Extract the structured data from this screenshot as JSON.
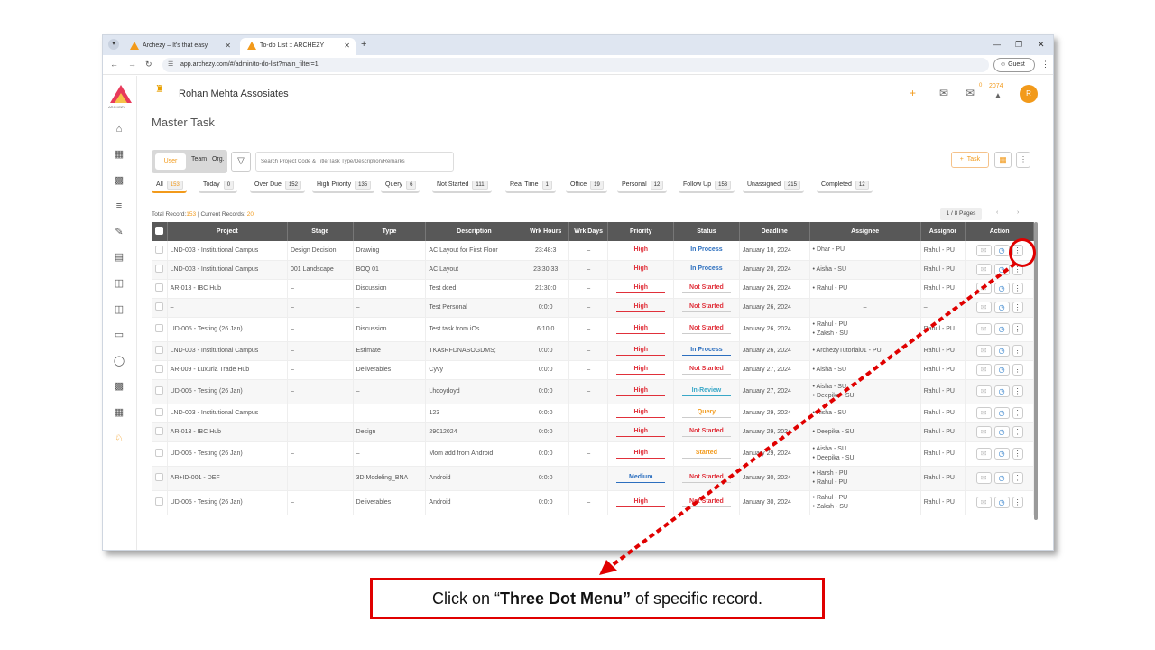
{
  "browser": {
    "tabs": [
      {
        "title": "Archezy – It's that easy"
      },
      {
        "title": "To-do List :: ARCHEZY"
      }
    ],
    "url": "app.archezy.com/#/admin/to-do-list?main_filter=1",
    "profile": "Guest"
  },
  "header": {
    "logo_text": "ARCHEZY",
    "org_name": "Rohan Mehta Assosiates",
    "chat_badge": "0",
    "notif_year": "2074",
    "avatar_letter": "R"
  },
  "page": {
    "title": "Master Task",
    "toggle": {
      "user": "User",
      "team": "Team",
      "org": "Org."
    },
    "search_placeholder": "Search Project Code & Title/Task Type/Description/Remarks",
    "add_task_label": "Task",
    "total_label": "Total Record:",
    "total_value": "153",
    "current_label": " | Current Records: ",
    "current_value": "20",
    "pager": "1 / 8 Pages"
  },
  "filters": [
    {
      "label": "All",
      "count": "153"
    },
    {
      "label": "Today",
      "count": "0"
    },
    {
      "label": "Over Due",
      "count": "152"
    },
    {
      "label": "High Priority",
      "count": "135"
    },
    {
      "label": "Query",
      "count": "6"
    },
    {
      "label": "Not Started",
      "count": "111"
    },
    {
      "label": "Real Time",
      "count": "1"
    },
    {
      "label": "Office",
      "count": "19"
    },
    {
      "label": "Personal",
      "count": "12"
    },
    {
      "label": "Follow Up",
      "count": "153"
    },
    {
      "label": "Unassigned",
      "count": "215"
    },
    {
      "label": "Completed",
      "count": "12"
    }
  ],
  "table": {
    "columns": [
      "Project",
      "Stage",
      "Type",
      "Description",
      "Wrk Hours",
      "Wrk Days",
      "Priority",
      "Status",
      "Deadline",
      "Assignee",
      "Assignor",
      "Action"
    ],
    "rows": [
      {
        "project": "LND-003 - Institutional Campus",
        "stage": "Design Decision",
        "type": "Drawing",
        "desc": "AC Layout for First Floor",
        "hours": "23:48:3",
        "days": "–",
        "priority": "High",
        "status": "In Process",
        "deadline": "January 10, 2024",
        "assignee": [
          "Dhar - PU"
        ],
        "assignor": "Rahul - PU"
      },
      {
        "project": "LND-003 - Institutional Campus",
        "stage": "001 Landscape",
        "type": "BOQ 01",
        "desc": "AC Layout",
        "hours": "23:30:33",
        "days": "–",
        "priority": "High",
        "status": "In Process",
        "deadline": "January 20, 2024",
        "assignee": [
          "Aisha - SU"
        ],
        "assignor": "Rahul - PU"
      },
      {
        "project": "AR-013 - IBC Hub",
        "stage": "–",
        "type": "Discussion",
        "desc": "Test dced",
        "hours": "21:30:0",
        "days": "–",
        "priority": "High",
        "status": "Not Started",
        "deadline": "January 26, 2024",
        "assignee": [
          "Rahul - PU"
        ],
        "assignor": "Rahul - PU"
      },
      {
        "project": "–",
        "stage": "–",
        "type": "–",
        "desc": "Test Personal",
        "hours": "0:0:0",
        "days": "–",
        "priority": "High",
        "status": "Not Started",
        "deadline": "January 26, 2024",
        "assignee": [],
        "assignee_dash": "–",
        "assignor": "–"
      },
      {
        "project": "UD-005 - Testing (26 Jan)",
        "stage": "–",
        "type": "Discussion",
        "desc": "Test task from iOs",
        "hours": "6:10:0",
        "days": "–",
        "priority": "High",
        "status": "Not Started",
        "deadline": "January 26, 2024",
        "assignee": [
          "Rahul - PU",
          "Zaksh - SU"
        ],
        "assignor": "Rahul - PU"
      },
      {
        "project": "LND-003 - Institutional Campus",
        "stage": "–",
        "type": "Estimate",
        "desc": "TKAsRFDNASOGDMS;",
        "hours": "0:0:0",
        "days": "–",
        "priority": "High",
        "status": "In Process",
        "deadline": "January 26, 2024",
        "assignee": [
          "ArchezyTutorial01 - PU"
        ],
        "assignor": "Rahul - PU"
      },
      {
        "project": "AR-009 - Luxuria Trade Hub",
        "stage": "–",
        "type": "Deliverables",
        "desc": "Cyvy",
        "hours": "0:0:0",
        "days": "–",
        "priority": "High",
        "status": "Not Started",
        "deadline": "January 27, 2024",
        "assignee": [
          "Aisha - SU"
        ],
        "assignor": "Rahul - PU"
      },
      {
        "project": "UD-005 - Testing (26 Jan)",
        "stage": "–",
        "type": "–",
        "desc": "Lhdoydoyd",
        "hours": "0:0:0",
        "days": "–",
        "priority": "High",
        "status": "In-Review",
        "deadline": "January 27, 2024",
        "assignee": [
          "Aisha - SU",
          "Deepika - SU"
        ],
        "assignor": "Rahul - PU"
      },
      {
        "project": "LND-003 - Institutional Campus",
        "stage": "–",
        "type": "–",
        "desc": "123",
        "hours": "0:0:0",
        "days": "–",
        "priority": "High",
        "status": "Query",
        "deadline": "January 29, 2024",
        "assignee": [
          "Aisha - SU"
        ],
        "assignor": "Rahul - PU"
      },
      {
        "project": "AR-013 - IBC Hub",
        "stage": "–",
        "type": "Design",
        "desc": "29012024",
        "hours": "0:0:0",
        "days": "–",
        "priority": "High",
        "status": "Not Started",
        "deadline": "January 29, 2024",
        "assignee": [
          "Deepika - SU"
        ],
        "assignor": "Rahul - PU"
      },
      {
        "project": "UD-005 - Testing (26 Jan)",
        "stage": "–",
        "type": "–",
        "desc": "Mom add from Android",
        "hours": "0:0:0",
        "days": "–",
        "priority": "High",
        "status": "Started",
        "deadline": "January 29, 2024",
        "assignee": [
          "Aisha - SU",
          "Deepika - SU"
        ],
        "assignor": "Rahul - PU"
      },
      {
        "project": "AR+ID-001 - DEF",
        "stage": "–",
        "type": "3D Modeling_BNA",
        "desc": "Android",
        "hours": "0:0:0",
        "days": "–",
        "priority": "Medium",
        "status": "Not Started",
        "deadline": "January 30, 2024",
        "assignee": [
          "Harsh - PU",
          "Rahul - PU"
        ],
        "assignor": "Rahul - PU"
      },
      {
        "project": "UD-005 - Testing (26 Jan)",
        "stage": "–",
        "type": "Deliverables",
        "desc": "Android",
        "hours": "0:0:0",
        "days": "–",
        "priority": "High",
        "status": "Not Started",
        "deadline": "January 30, 2024",
        "assignee": [
          "Rahul - PU",
          "Zaksh - SU"
        ],
        "assignor": "Rahul - PU"
      }
    ]
  },
  "colors": {
    "accent": "#f29a1b",
    "high": "#e0303a",
    "medium": "#2c6fbf",
    "in_process": "#2c6fbf",
    "not_started": "#e0303a",
    "in_review": "#3aa8c8",
    "query": "#f29a1b",
    "started": "#f29a1b"
  },
  "callout": {
    "prefix": "Click on “",
    "bold": "Three Dot Menu”",
    "suffix": " of specific record."
  }
}
